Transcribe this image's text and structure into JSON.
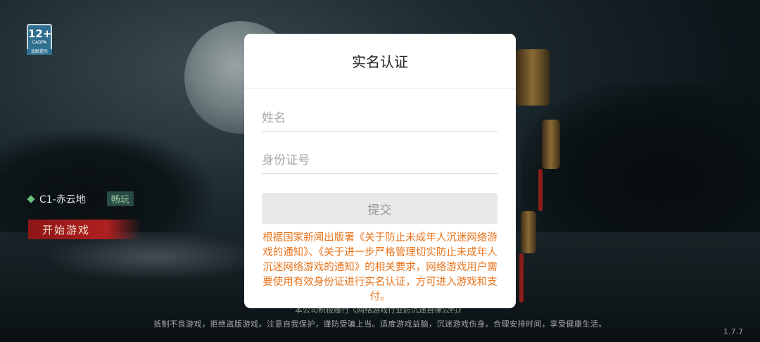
{
  "age_rating": {
    "label": "12+",
    "org": "CADPA",
    "tip": "适龄提示"
  },
  "server": {
    "name": "C1-赤云地",
    "status": "畅玩"
  },
  "start_button": "开始游戏",
  "footer": {
    "line1": "本公司积极履行《网络游戏行业防沉迷自律公约》",
    "line2": "抵制不良游戏，拒绝盗版游戏。注意自我保护，谨防受骗上当。适度游戏益脑，沉迷游戏伤身。合理安排时间，享受健康生活。"
  },
  "version": "1.7.7",
  "modal": {
    "title": "实名认证",
    "name_placeholder": "姓名",
    "id_placeholder": "身份证号",
    "submit_label": "提交",
    "notice": "根据国家新闻出版署《关于防止未成年人沉迷网络游戏的通知》、《关于进一步严格管理切实防止未成年人沉迷网络游戏的通知》的相关要求，网络游戏用户需要使用有效身份证进行实名认证，方可进入游戏和支付。"
  },
  "colors": {
    "notice": "#e8741c",
    "start_button": "#b02020",
    "submit_bg": "#e9e9e9"
  }
}
